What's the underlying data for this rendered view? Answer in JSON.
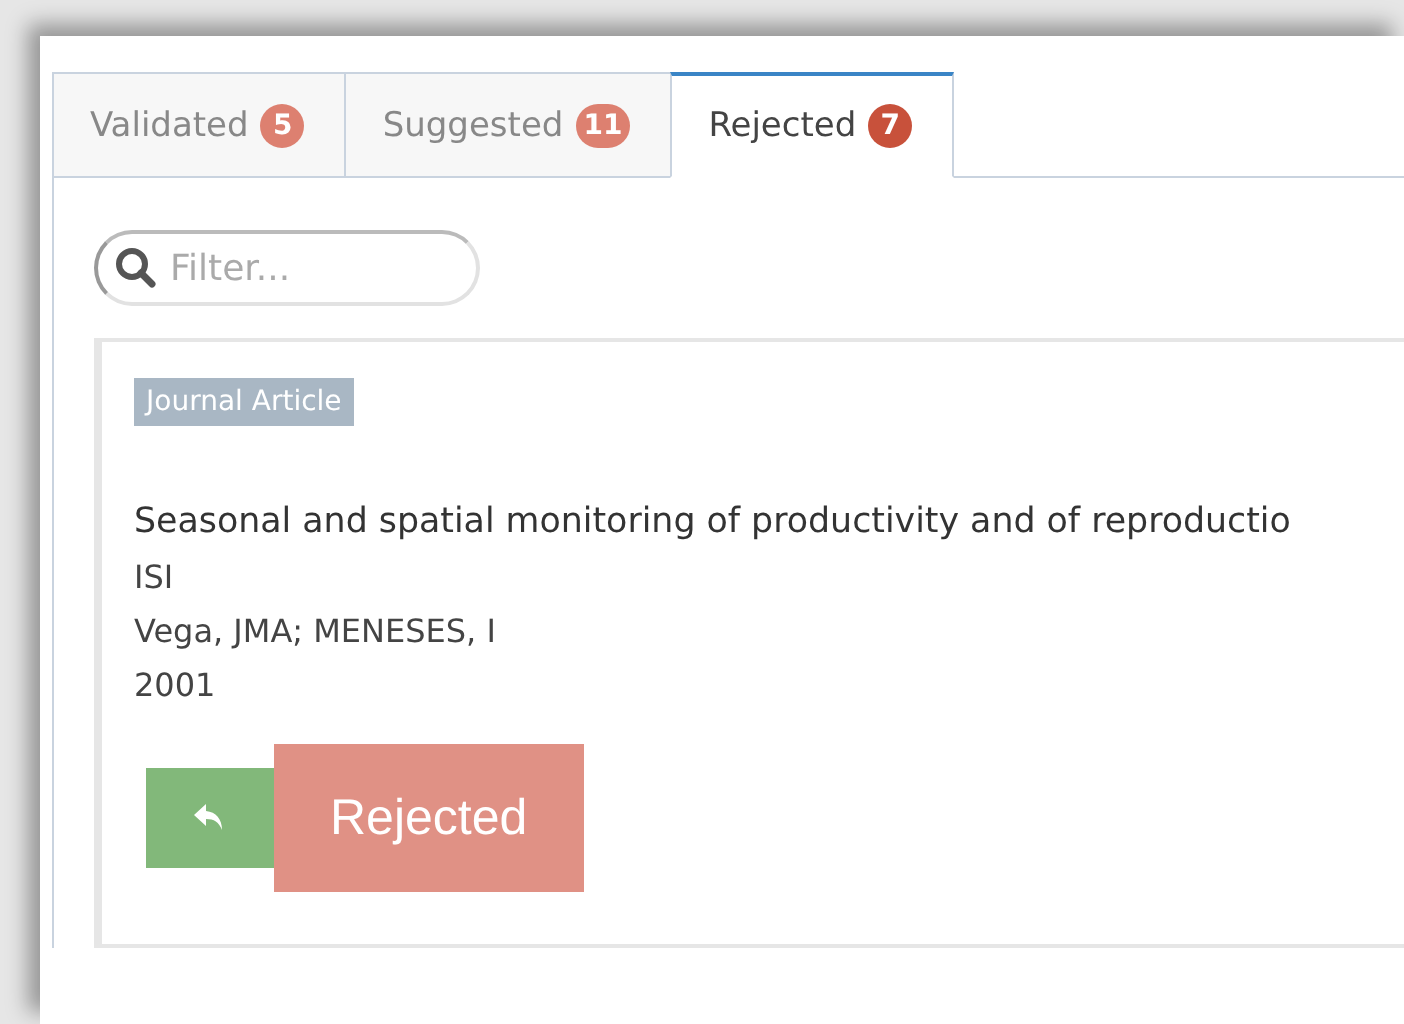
{
  "tabs": [
    {
      "label": "Validated",
      "count": "5",
      "selected": false
    },
    {
      "label": "Suggested",
      "count": "11",
      "selected": false
    },
    {
      "label": "Rejected",
      "count": "7",
      "selected": true
    }
  ],
  "filter": {
    "placeholder": "Filter..."
  },
  "records": [
    {
      "type": "Journal Article",
      "title": "Seasonal and spatial monitoring of productivity and of reproductio",
      "source": "ISI",
      "authors": "Vega, JMA; MENESES, I",
      "year": "2001",
      "status": "Rejected"
    }
  ]
}
